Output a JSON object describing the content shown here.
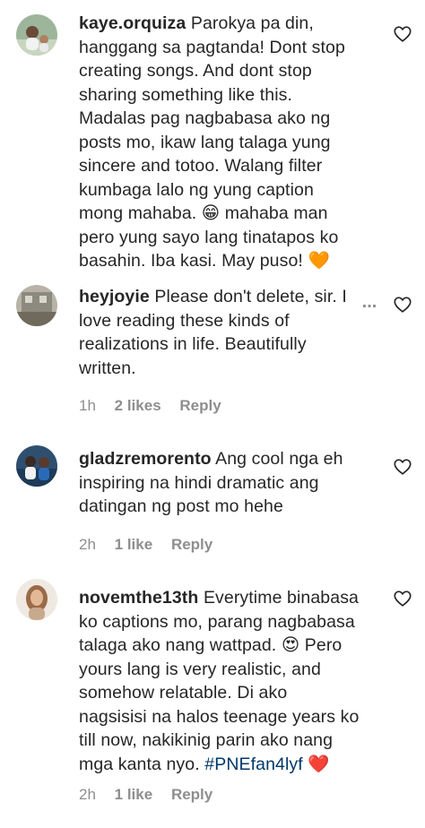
{
  "comments": [
    {
      "username": "kaye.orquiza",
      "lines": [
        "Parokya pa din,",
        "hanggang sa pagtanda! Dont stop",
        "creating songs. And dont stop",
        "sharing something like this.",
        "Madalas pag nagbabasa ako ng",
        "posts mo, ikaw lang talaga yung",
        "sincere and totoo. Walang filter",
        "kumbaga lalo ng yung caption",
        "mong mahaba. 😁 mahaba man",
        "pero yung sayo lang tinatapos ko",
        "basahin. Iba kasi. May puso! 🧡"
      ],
      "time": "",
      "likes": "",
      "reply": ""
    },
    {
      "username": "heyjoyie",
      "lines": [
        "Please don't delete, sir. I",
        "love reading these kinds of",
        "realizations in life. Beautifully",
        "written."
      ],
      "more_label": "...",
      "time": "1h",
      "likes": "2 likes",
      "reply": "Reply"
    },
    {
      "username": "gladzremorento",
      "lines": [
        "Ang cool nga eh",
        "inspiring na hindi dramatic ang",
        "datingan ng post mo hehe"
      ],
      "time": "2h",
      "likes": "1 like",
      "reply": "Reply"
    },
    {
      "username": "novemthe13th",
      "lines": [
        "Everytime binabasa",
        "ko captions mo, parang nagbabasa",
        "talaga ako nang wattpad. 😍 Pero",
        "yours lang is very realistic, and",
        "somehow relatable. Di ako",
        "nagsisisi na halos teenage years ko",
        "till now, nakikinig parin ako nang",
        "mga kanta nyo."
      ],
      "hashtag": "#PNEfan4lyf",
      "end_emoji": "❤️",
      "time": "2h",
      "likes": "1 like",
      "reply": "Reply"
    }
  ],
  "icons": {
    "like": "heart-outline-icon",
    "more": "more-dots-icon"
  },
  "colors": {
    "text": "#262626",
    "meta": "#8e8e8e",
    "hashtag": "#00376b"
  }
}
